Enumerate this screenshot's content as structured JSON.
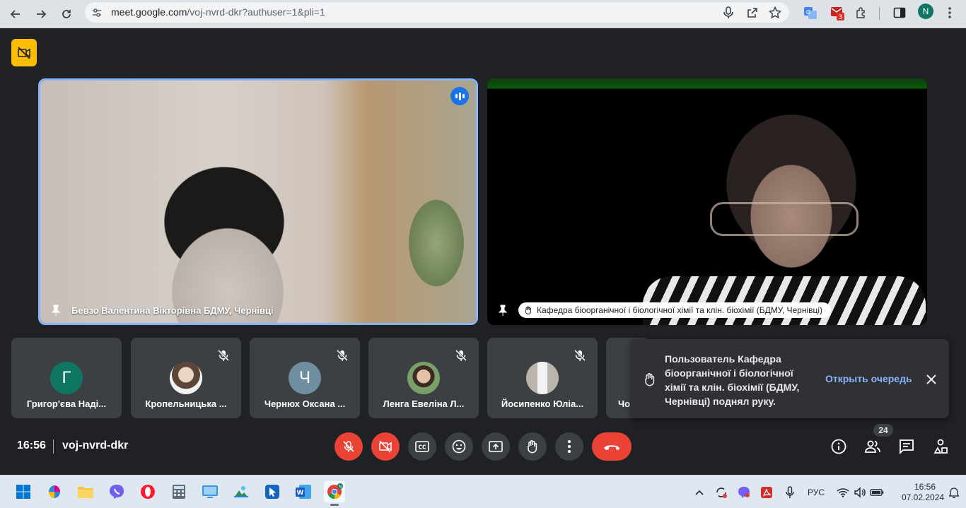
{
  "browser": {
    "url_host": "meet.google.com",
    "url_path": "/voj-nvrd-dkr?authuser=1&pli=1",
    "ext_badge": "3",
    "profile_initial": "N"
  },
  "main_tiles": [
    {
      "name": "Бевзо Валентина Вікторівна БДМУ, Чернівці"
    },
    {
      "name": "Кафедра біоорганічної і біологічної хімії та клін. біохімії (БДМУ, Чернівці)"
    }
  ],
  "filmstrip": [
    {
      "initial": "Г",
      "name": "Григор'єва Наді...",
      "avatar_color": "#0f7663"
    },
    {
      "initial": "",
      "name": "Кропельницька ...",
      "avatar_color": "#c9b7a6"
    },
    {
      "initial": "Ч",
      "name": "Чернюх Оксана ...",
      "avatar_color": "#6f8fa0"
    },
    {
      "initial": "",
      "name": "Ленга Евеліна Л...",
      "avatar_color": "#7aa06a"
    },
    {
      "initial": "",
      "name": "Йосипенко Юліа...",
      "avatar_color": "#b9b5ad"
    },
    {
      "initial": "",
      "name": "Чо",
      "avatar_color": "#3c4043"
    }
  ],
  "toast": {
    "message": "Пользователь Кафедра біоорганічної і біологічної хімії та клін. біохімії (БДМУ, Чернівці) поднял руку.",
    "action": "Открыть очередь"
  },
  "controls": {
    "time": "16:56",
    "meeting_code": "voj-nvrd-dkr",
    "participants_count": "24"
  },
  "taskbar": {
    "language": "РУС",
    "time": "16:56",
    "date": "07.02.2024"
  },
  "colors": {
    "meet_bg": "#202124",
    "accent_blue": "#8ab4f8",
    "danger_red": "#ea4335",
    "badge_yellow": "#fbbc04"
  }
}
